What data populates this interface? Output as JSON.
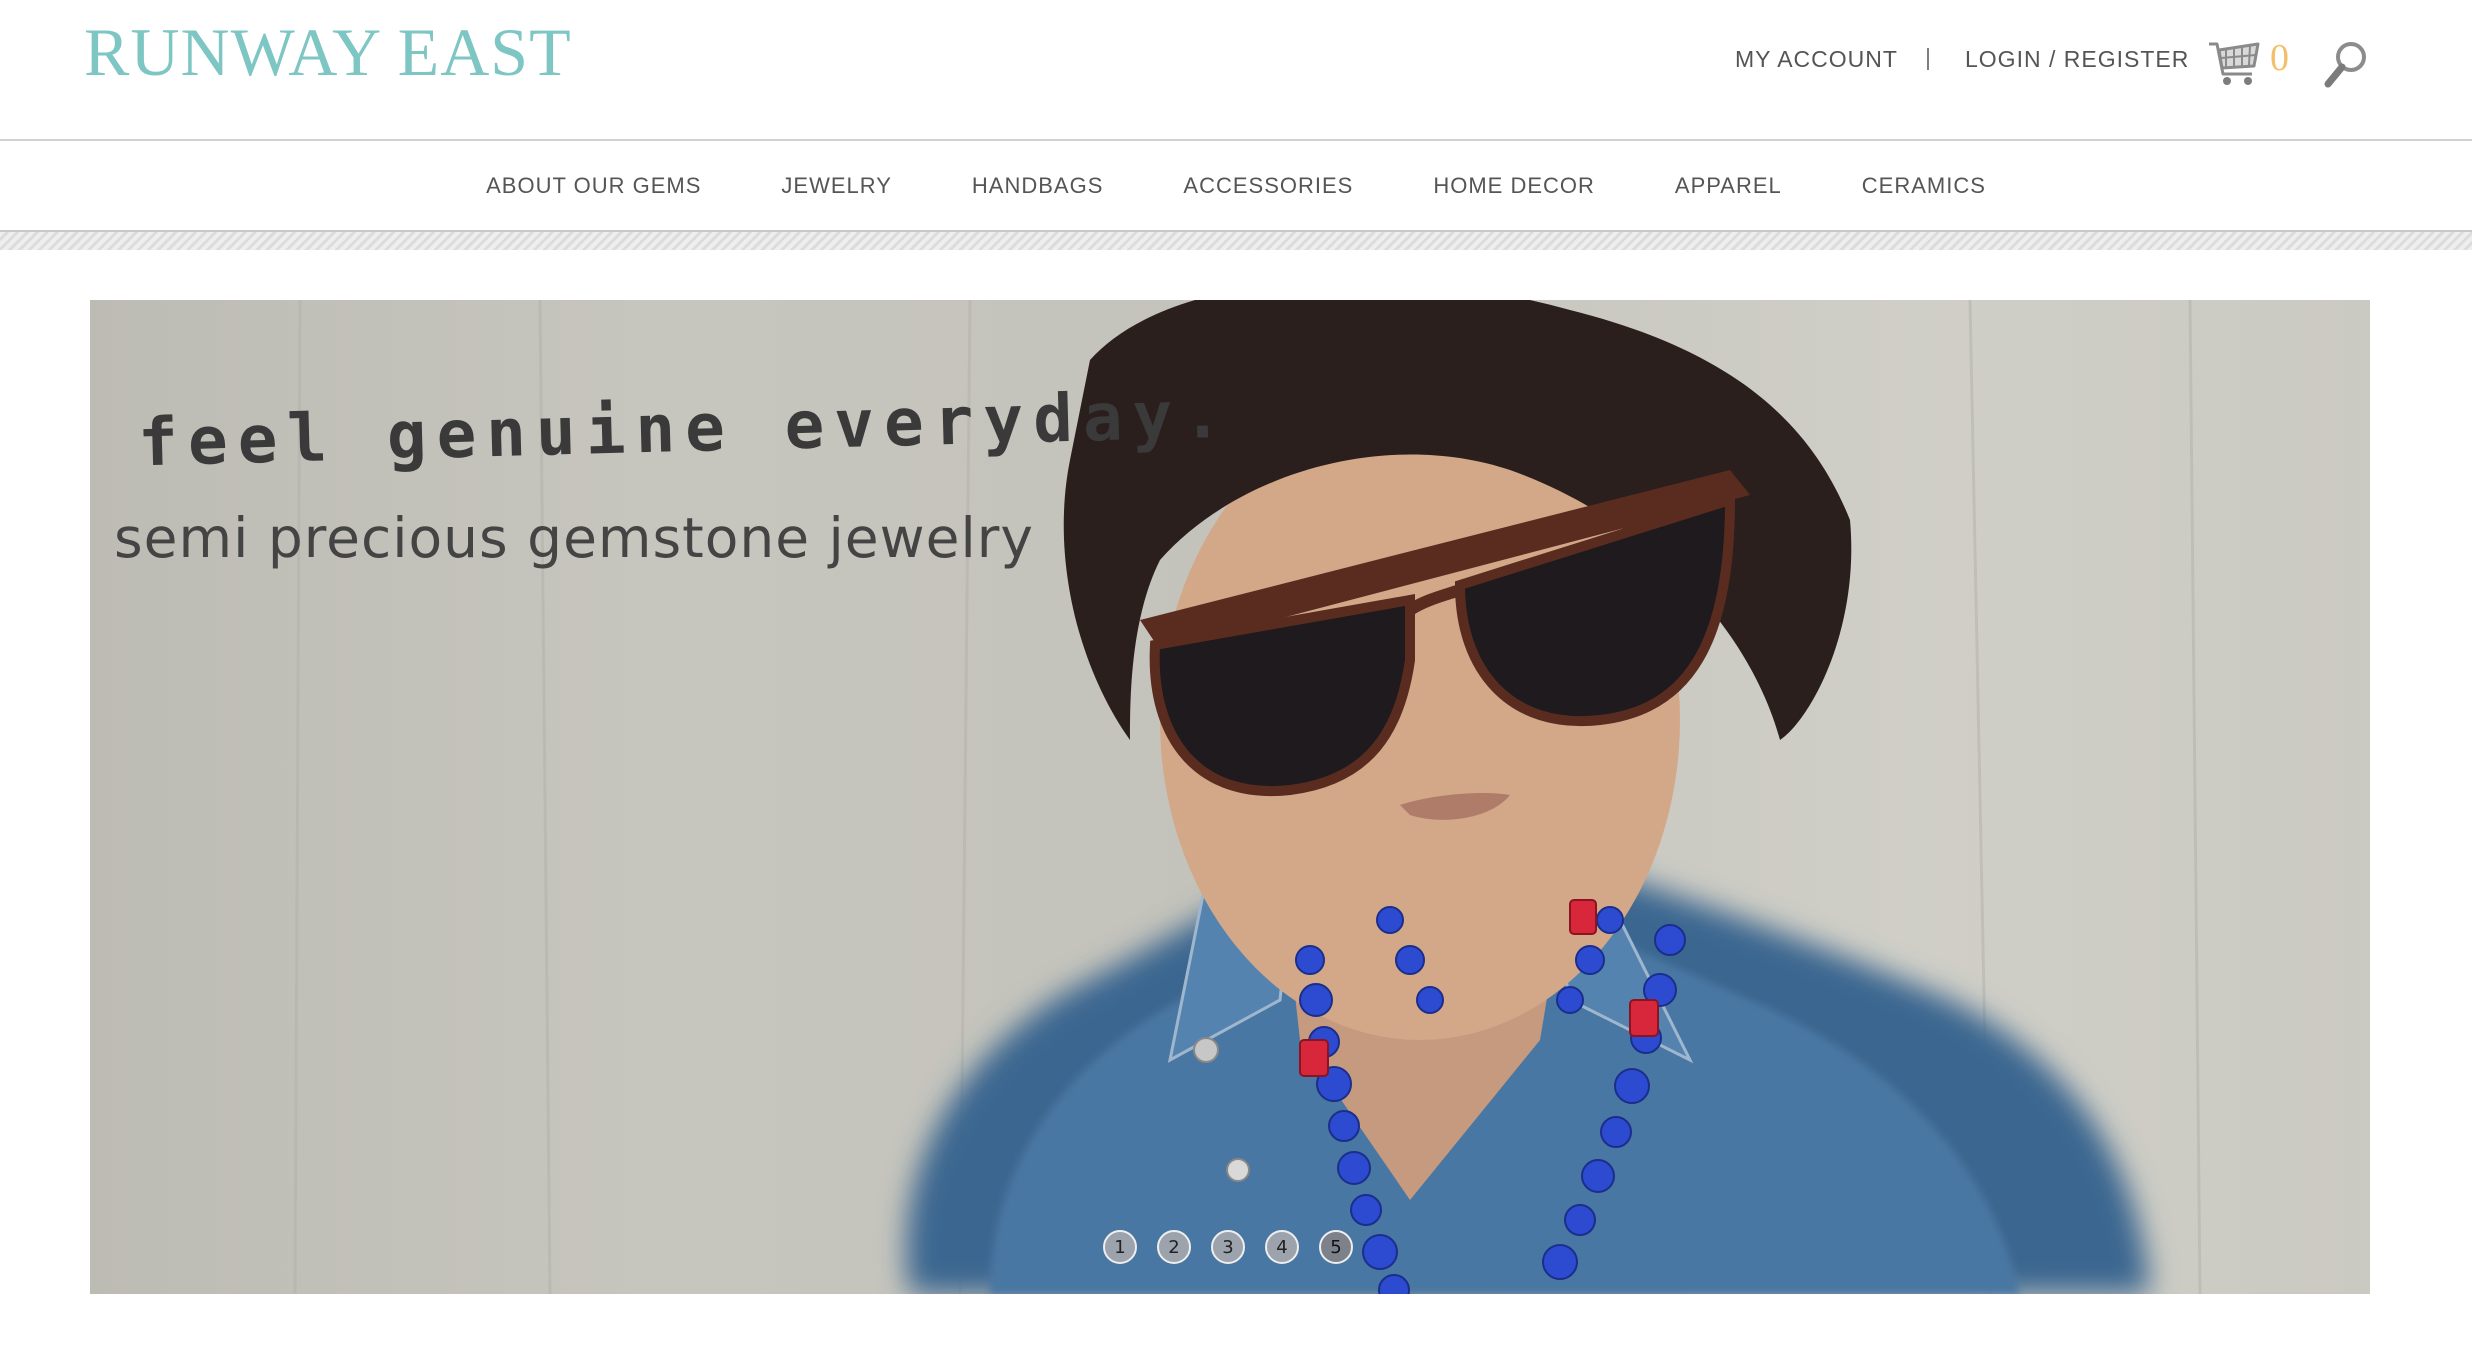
{
  "brand": {
    "logo_text": "RUNWAY EAST"
  },
  "header": {
    "my_account_label": "MY ACCOUNT",
    "separator": "|",
    "login_register_label": "LOGIN / REGISTER",
    "cart_count": "0",
    "icons": {
      "cart": "shopping-cart-icon",
      "search": "magnifier-icon"
    }
  },
  "nav": {
    "items": [
      {
        "label": "ABOUT OUR GEMS"
      },
      {
        "label": "JEWELRY"
      },
      {
        "label": "HANDBAGS"
      },
      {
        "label": "ACCESSORIES"
      },
      {
        "label": "HOME DECOR"
      },
      {
        "label": "APPAREL"
      },
      {
        "label": "CERAMICS"
      }
    ]
  },
  "hero": {
    "tagline": "feel genuine everyday.",
    "subtitle": "semi precious gemstone jewelry",
    "pager": [
      "1",
      "2",
      "3",
      "4",
      "5"
    ],
    "active_slide": "5"
  },
  "colors": {
    "logo": "#7ec6c3",
    "cart_count": "#f2bf6a",
    "nav_text": "#555555"
  }
}
